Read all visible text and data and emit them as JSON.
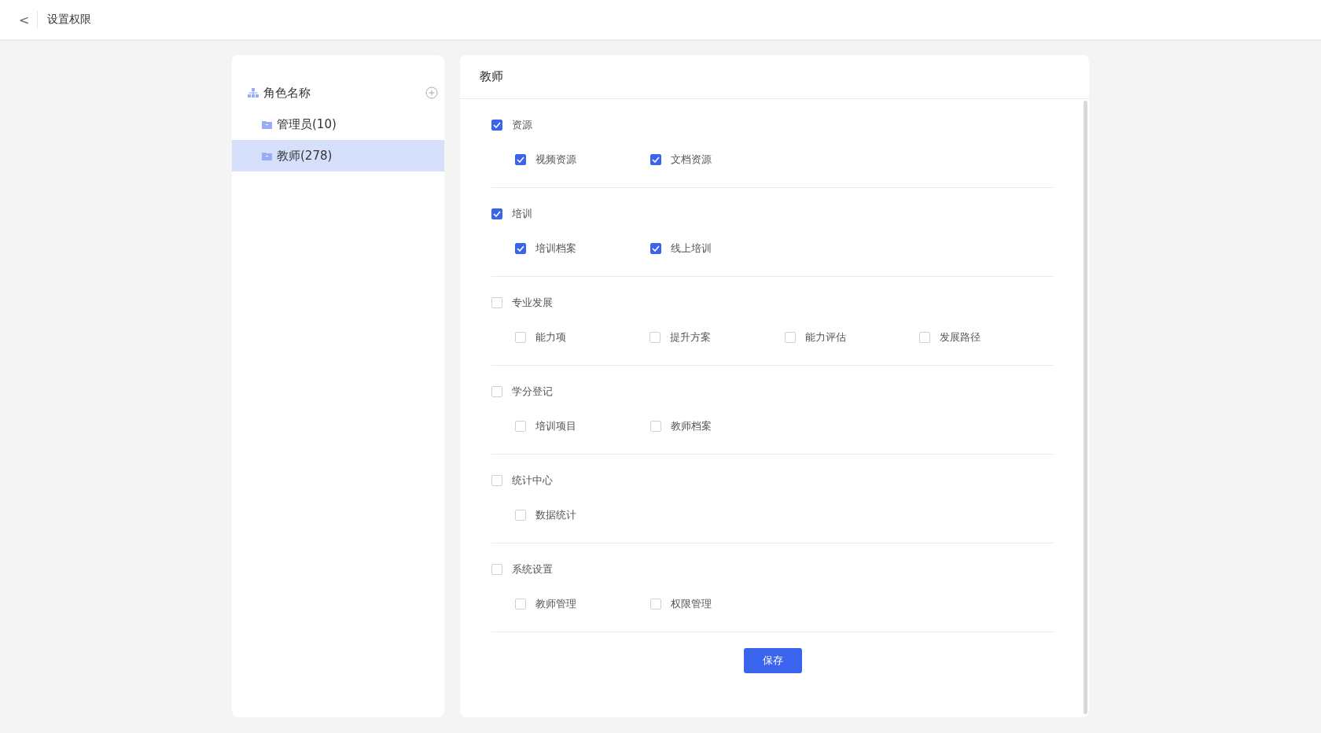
{
  "header": {
    "back_icon": "<",
    "title": "设置权限"
  },
  "roles": {
    "title": "角色名称",
    "items": [
      {
        "label": "管理员(10)",
        "selected": false
      },
      {
        "label": "教师(278)",
        "selected": true
      }
    ]
  },
  "permissions": {
    "title": "教师",
    "groups": [
      {
        "label": "资源",
        "checked": true,
        "children": [
          {
            "label": "视频资源",
            "checked": true
          },
          {
            "label": "文档资源",
            "checked": true
          }
        ]
      },
      {
        "label": "培训",
        "checked": true,
        "children": [
          {
            "label": "培训档案",
            "checked": true
          },
          {
            "label": "线上培训",
            "checked": true
          }
        ]
      },
      {
        "label": "专业发展",
        "checked": false,
        "children": [
          {
            "label": "能力项",
            "checked": false
          },
          {
            "label": "提升方案",
            "checked": false
          },
          {
            "label": "能力评估",
            "checked": false
          },
          {
            "label": "发展路径",
            "checked": false
          }
        ]
      },
      {
        "label": "学分登记",
        "checked": false,
        "children": [
          {
            "label": "培训项目",
            "checked": false
          },
          {
            "label": "教师档案",
            "checked": false
          }
        ]
      },
      {
        "label": "统计中心",
        "checked": false,
        "children": [
          {
            "label": "数据统计",
            "checked": false
          }
        ]
      },
      {
        "label": "系统设置",
        "checked": false,
        "children": [
          {
            "label": "教师管理",
            "checked": false
          },
          {
            "label": "权限管理",
            "checked": false
          }
        ]
      }
    ],
    "save_button": "保存"
  }
}
